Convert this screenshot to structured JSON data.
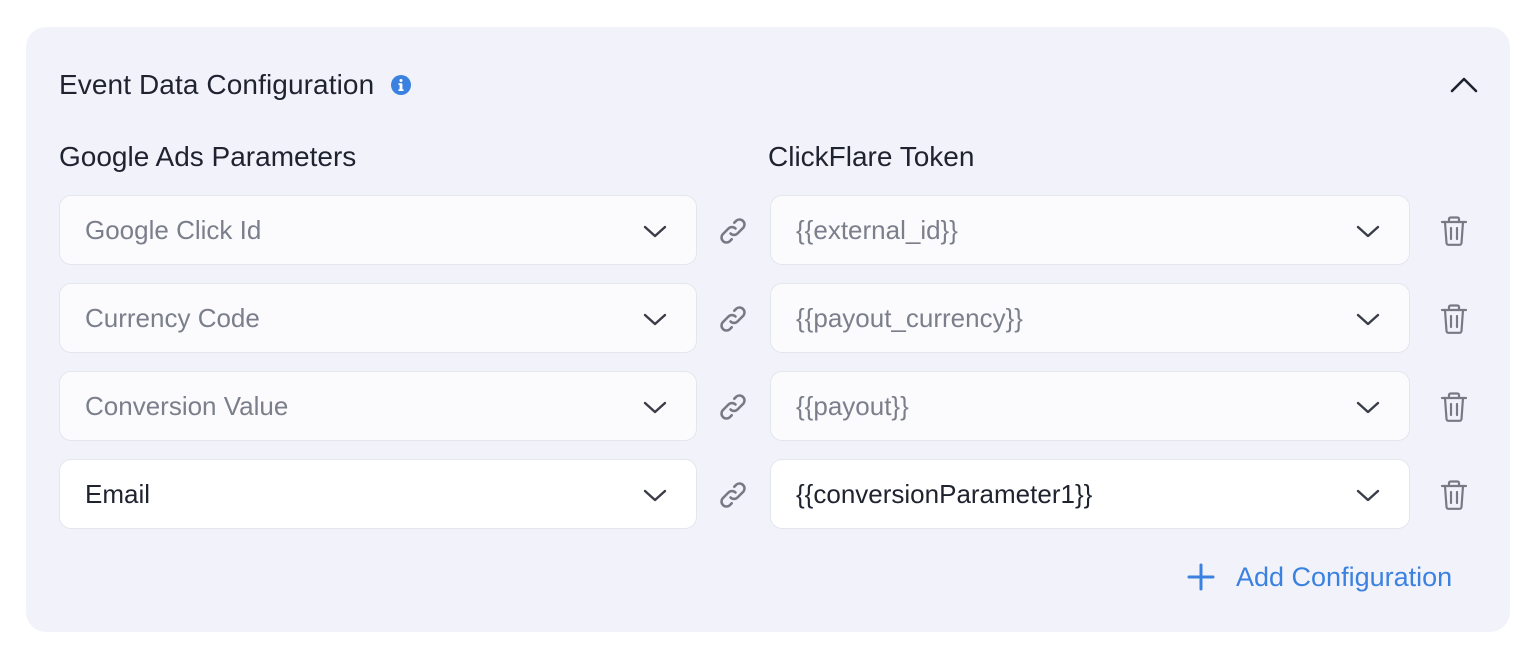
{
  "panel": {
    "title": "Event Data Configuration",
    "info_icon": "info-circle-icon",
    "collapse_icon": "chevron-up-icon"
  },
  "columns": {
    "left_header": "Google Ads Parameters",
    "right_header": "ClickFlare Token"
  },
  "rows": [
    {
      "parameter": "Google Click Id",
      "token": "{{external_id}}",
      "filled": false
    },
    {
      "parameter": "Currency Code",
      "token": "{{payout_currency}}",
      "filled": false
    },
    {
      "parameter": "Conversion Value",
      "token": "{{payout}}",
      "filled": false
    },
    {
      "parameter": "Email",
      "token": "{{conversionParameter1}}",
      "filled": true
    }
  ],
  "add_button": {
    "label": "Add Configuration",
    "icon": "plus-icon"
  },
  "colors": {
    "panel_bg": "#f2f3fa",
    "accent": "#3b82e0",
    "text_primary": "#1f2330",
    "text_muted": "#7b7f8c",
    "icon_gray": "#777a85"
  }
}
